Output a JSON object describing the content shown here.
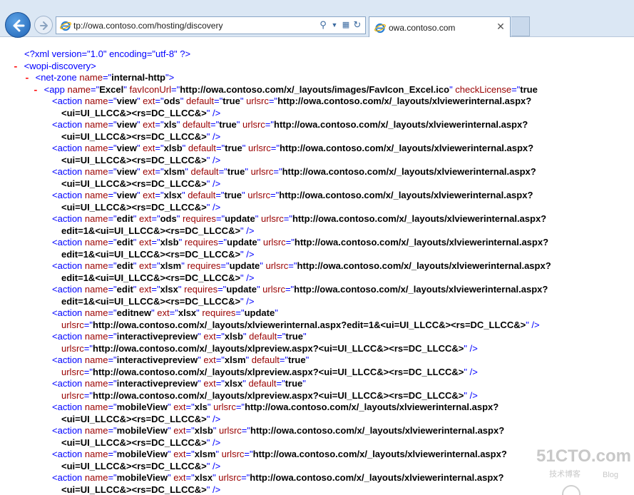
{
  "browser": {
    "address_text": "tp://owa.contoso.com/hosting/discovery",
    "tab_title": "owa.contoso.com",
    "icons": [
      "back-arrow-icon",
      "forward-arrow-icon",
      "ie-logo-icon",
      "search-icon",
      "dropdown-icon",
      "compatibility-icon",
      "refresh-icon",
      "close-icon"
    ],
    "colors": {
      "chrome": "#dbe7f4",
      "tag": "#0000ff",
      "attr_name": "#990000",
      "attr_value": "#000000"
    }
  },
  "xml": {
    "lines": [
      [
        [
          "t",
          "<?xml version=\"1.0\" encoding=\"utf-8\" ?>"
        ]
      ],
      [
        [
          "m",
          "- "
        ],
        [
          "t",
          "<wopi-discovery>"
        ]
      ],
      [
        [
          "m",
          "- "
        ],
        [
          "t",
          "<net-zone "
        ],
        [
          "a",
          "name"
        ],
        [
          "t",
          "=\""
        ],
        [
          "v",
          "internal-http"
        ],
        [
          "t",
          "\">"
        ]
      ],
      [
        [
          "m",
          "- "
        ],
        [
          "t",
          "<app "
        ],
        [
          "a",
          "name"
        ],
        [
          "t",
          "=\""
        ],
        [
          "v",
          "Excel"
        ],
        [
          "t",
          "\" "
        ],
        [
          "a",
          "favIconUrl"
        ],
        [
          "t",
          "=\""
        ],
        [
          "v",
          "http://owa.contoso.com/x/_layouts/images/FavIcon_Excel.ico"
        ],
        [
          "t",
          "\" "
        ],
        [
          "a",
          "checkLicense"
        ],
        [
          "t",
          "=\""
        ],
        [
          "v",
          "true"
        ]
      ],
      [
        [
          "t",
          "<action "
        ],
        [
          "a",
          "name"
        ],
        [
          "t",
          "=\""
        ],
        [
          "v",
          "view"
        ],
        [
          "t",
          "\" "
        ],
        [
          "a",
          "ext"
        ],
        [
          "t",
          "=\""
        ],
        [
          "v",
          "ods"
        ],
        [
          "t",
          "\" "
        ],
        [
          "a",
          "default"
        ],
        [
          "t",
          "=\""
        ],
        [
          "v",
          "true"
        ],
        [
          "t",
          "\" "
        ],
        [
          "a",
          "urlsrc"
        ],
        [
          "t",
          "=\""
        ],
        [
          "v",
          "http://owa.contoso.com/x/_layouts/xlviewerinternal.aspx?"
        ]
      ],
      [
        [
          "v",
          "<ui=UI_LLCC&><rs=DC_LLCC&>"
        ],
        [
          "t",
          "\" />"
        ]
      ],
      [
        [
          "t",
          "<action "
        ],
        [
          "a",
          "name"
        ],
        [
          "t",
          "=\""
        ],
        [
          "v",
          "view"
        ],
        [
          "t",
          "\" "
        ],
        [
          "a",
          "ext"
        ],
        [
          "t",
          "=\""
        ],
        [
          "v",
          "xls"
        ],
        [
          "t",
          "\" "
        ],
        [
          "a",
          "default"
        ],
        [
          "t",
          "=\""
        ],
        [
          "v",
          "true"
        ],
        [
          "t",
          "\" "
        ],
        [
          "a",
          "urlsrc"
        ],
        [
          "t",
          "=\""
        ],
        [
          "v",
          "http://owa.contoso.com/x/_layouts/xlviewerinternal.aspx?"
        ]
      ],
      [
        [
          "v",
          "<ui=UI_LLCC&><rs=DC_LLCC&>"
        ],
        [
          "t",
          "\" />"
        ]
      ],
      [
        [
          "t",
          "<action "
        ],
        [
          "a",
          "name"
        ],
        [
          "t",
          "=\""
        ],
        [
          "v",
          "view"
        ],
        [
          "t",
          "\" "
        ],
        [
          "a",
          "ext"
        ],
        [
          "t",
          "=\""
        ],
        [
          "v",
          "xlsb"
        ],
        [
          "t",
          "\" "
        ],
        [
          "a",
          "default"
        ],
        [
          "t",
          "=\""
        ],
        [
          "v",
          "true"
        ],
        [
          "t",
          "\" "
        ],
        [
          "a",
          "urlsrc"
        ],
        [
          "t",
          "=\""
        ],
        [
          "v",
          "http://owa.contoso.com/x/_layouts/xlviewerinternal.aspx?"
        ]
      ],
      [
        [
          "v",
          "<ui=UI_LLCC&><rs=DC_LLCC&>"
        ],
        [
          "t",
          "\" />"
        ]
      ],
      [
        [
          "t",
          "<action "
        ],
        [
          "a",
          "name"
        ],
        [
          "t",
          "=\""
        ],
        [
          "v",
          "view"
        ],
        [
          "t",
          "\" "
        ],
        [
          "a",
          "ext"
        ],
        [
          "t",
          "=\""
        ],
        [
          "v",
          "xlsm"
        ],
        [
          "t",
          "\" "
        ],
        [
          "a",
          "default"
        ],
        [
          "t",
          "=\""
        ],
        [
          "v",
          "true"
        ],
        [
          "t",
          "\" "
        ],
        [
          "a",
          "urlsrc"
        ],
        [
          "t",
          "=\""
        ],
        [
          "v",
          "http://owa.contoso.com/x/_layouts/xlviewerinternal.aspx?"
        ]
      ],
      [
        [
          "v",
          "<ui=UI_LLCC&><rs=DC_LLCC&>"
        ],
        [
          "t",
          "\" />"
        ]
      ],
      [
        [
          "t",
          "<action "
        ],
        [
          "a",
          "name"
        ],
        [
          "t",
          "=\""
        ],
        [
          "v",
          "view"
        ],
        [
          "t",
          "\" "
        ],
        [
          "a",
          "ext"
        ],
        [
          "t",
          "=\""
        ],
        [
          "v",
          "xlsx"
        ],
        [
          "t",
          "\" "
        ],
        [
          "a",
          "default"
        ],
        [
          "t",
          "=\""
        ],
        [
          "v",
          "true"
        ],
        [
          "t",
          "\" "
        ],
        [
          "a",
          "urlsrc"
        ],
        [
          "t",
          "=\""
        ],
        [
          "v",
          "http://owa.contoso.com/x/_layouts/xlviewerinternal.aspx?"
        ]
      ],
      [
        [
          "v",
          "<ui=UI_LLCC&><rs=DC_LLCC&>"
        ],
        [
          "t",
          "\" />"
        ]
      ],
      [
        [
          "t",
          "<action "
        ],
        [
          "a",
          "name"
        ],
        [
          "t",
          "=\""
        ],
        [
          "v",
          "edit"
        ],
        [
          "t",
          "\" "
        ],
        [
          "a",
          "ext"
        ],
        [
          "t",
          "=\""
        ],
        [
          "v",
          "ods"
        ],
        [
          "t",
          "\" "
        ],
        [
          "a",
          "requires"
        ],
        [
          "t",
          "=\""
        ],
        [
          "v",
          "update"
        ],
        [
          "t",
          "\" "
        ],
        [
          "a",
          "urlsrc"
        ],
        [
          "t",
          "=\""
        ],
        [
          "v",
          "http://owa.contoso.com/x/_layouts/xlviewerinternal.aspx?"
        ]
      ],
      [
        [
          "v",
          "edit=1&<ui=UI_LLCC&><rs=DC_LLCC&>"
        ],
        [
          "t",
          "\" />"
        ]
      ],
      [
        [
          "t",
          "<action "
        ],
        [
          "a",
          "name"
        ],
        [
          "t",
          "=\""
        ],
        [
          "v",
          "edit"
        ],
        [
          "t",
          "\" "
        ],
        [
          "a",
          "ext"
        ],
        [
          "t",
          "=\""
        ],
        [
          "v",
          "xlsb"
        ],
        [
          "t",
          "\" "
        ],
        [
          "a",
          "requires"
        ],
        [
          "t",
          "=\""
        ],
        [
          "v",
          "update"
        ],
        [
          "t",
          "\" "
        ],
        [
          "a",
          "urlsrc"
        ],
        [
          "t",
          "=\""
        ],
        [
          "v",
          "http://owa.contoso.com/x/_layouts/xlviewerinternal.aspx?"
        ]
      ],
      [
        [
          "v",
          "edit=1&<ui=UI_LLCC&><rs=DC_LLCC&>"
        ],
        [
          "t",
          "\" />"
        ]
      ],
      [
        [
          "t",
          "<action "
        ],
        [
          "a",
          "name"
        ],
        [
          "t",
          "=\""
        ],
        [
          "v",
          "edit"
        ],
        [
          "t",
          "\" "
        ],
        [
          "a",
          "ext"
        ],
        [
          "t",
          "=\""
        ],
        [
          "v",
          "xlsm"
        ],
        [
          "t",
          "\" "
        ],
        [
          "a",
          "requires"
        ],
        [
          "t",
          "=\""
        ],
        [
          "v",
          "update"
        ],
        [
          "t",
          "\" "
        ],
        [
          "a",
          "urlsrc"
        ],
        [
          "t",
          "=\""
        ],
        [
          "v",
          "http://owa.contoso.com/x/_layouts/xlviewerinternal.aspx?"
        ]
      ],
      [
        [
          "v",
          "edit=1&<ui=UI_LLCC&><rs=DC_LLCC&>"
        ],
        [
          "t",
          "\" />"
        ]
      ],
      [
        [
          "t",
          "<action "
        ],
        [
          "a",
          "name"
        ],
        [
          "t",
          "=\""
        ],
        [
          "v",
          "edit"
        ],
        [
          "t",
          "\" "
        ],
        [
          "a",
          "ext"
        ],
        [
          "t",
          "=\""
        ],
        [
          "v",
          "xlsx"
        ],
        [
          "t",
          "\" "
        ],
        [
          "a",
          "requires"
        ],
        [
          "t",
          "=\""
        ],
        [
          "v",
          "update"
        ],
        [
          "t",
          "\" "
        ],
        [
          "a",
          "urlsrc"
        ],
        [
          "t",
          "=\""
        ],
        [
          "v",
          "http://owa.contoso.com/x/_layouts/xlviewerinternal.aspx?"
        ]
      ],
      [
        [
          "v",
          "edit=1&<ui=UI_LLCC&><rs=DC_LLCC&>"
        ],
        [
          "t",
          "\" />"
        ]
      ],
      [
        [
          "t",
          "<action "
        ],
        [
          "a",
          "name"
        ],
        [
          "t",
          "=\""
        ],
        [
          "v",
          "editnew"
        ],
        [
          "t",
          "\" "
        ],
        [
          "a",
          "ext"
        ],
        [
          "t",
          "=\""
        ],
        [
          "v",
          "xlsx"
        ],
        [
          "t",
          "\" "
        ],
        [
          "a",
          "requires"
        ],
        [
          "t",
          "=\""
        ],
        [
          "v",
          "update"
        ],
        [
          "t",
          "\""
        ]
      ],
      [
        [
          "a",
          "urlsrc"
        ],
        [
          "t",
          "=\""
        ],
        [
          "v",
          "http://owa.contoso.com/x/_layouts/xlviewerinternal.aspx?edit=1&<ui=UI_LLCC&><rs=DC_LLCC&>"
        ],
        [
          "t",
          "\" />"
        ]
      ],
      [
        [
          "t",
          "<action "
        ],
        [
          "a",
          "name"
        ],
        [
          "t",
          "=\""
        ],
        [
          "v",
          "interactivepreview"
        ],
        [
          "t",
          "\" "
        ],
        [
          "a",
          "ext"
        ],
        [
          "t",
          "=\""
        ],
        [
          "v",
          "xlsb"
        ],
        [
          "t",
          "\" "
        ],
        [
          "a",
          "default"
        ],
        [
          "t",
          "=\""
        ],
        [
          "v",
          "true"
        ],
        [
          "t",
          "\""
        ]
      ],
      [
        [
          "a",
          "urlsrc"
        ],
        [
          "t",
          "=\""
        ],
        [
          "v",
          "http://owa.contoso.com/x/_layouts/xlpreview.aspx?<ui=UI_LLCC&><rs=DC_LLCC&>"
        ],
        [
          "t",
          "\" />"
        ]
      ],
      [
        [
          "t",
          "<action "
        ],
        [
          "a",
          "name"
        ],
        [
          "t",
          "=\""
        ],
        [
          "v",
          "interactivepreview"
        ],
        [
          "t",
          "\" "
        ],
        [
          "a",
          "ext"
        ],
        [
          "t",
          "=\""
        ],
        [
          "v",
          "xlsm"
        ],
        [
          "t",
          "\" "
        ],
        [
          "a",
          "default"
        ],
        [
          "t",
          "=\""
        ],
        [
          "v",
          "true"
        ],
        [
          "t",
          "\""
        ]
      ],
      [
        [
          "a",
          "urlsrc"
        ],
        [
          "t",
          "=\""
        ],
        [
          "v",
          "http://owa.contoso.com/x/_layouts/xlpreview.aspx?<ui=UI_LLCC&><rs=DC_LLCC&>"
        ],
        [
          "t",
          "\" />"
        ]
      ],
      [
        [
          "t",
          "<action "
        ],
        [
          "a",
          "name"
        ],
        [
          "t",
          "=\""
        ],
        [
          "v",
          "interactivepreview"
        ],
        [
          "t",
          "\" "
        ],
        [
          "a",
          "ext"
        ],
        [
          "t",
          "=\""
        ],
        [
          "v",
          "xlsx"
        ],
        [
          "t",
          "\" "
        ],
        [
          "a",
          "default"
        ],
        [
          "t",
          "=\""
        ],
        [
          "v",
          "true"
        ],
        [
          "t",
          "\""
        ]
      ],
      [
        [
          "a",
          "urlsrc"
        ],
        [
          "t",
          "=\""
        ],
        [
          "v",
          "http://owa.contoso.com/x/_layouts/xlpreview.aspx?<ui=UI_LLCC&><rs=DC_LLCC&>"
        ],
        [
          "t",
          "\" />"
        ]
      ],
      [
        [
          "t",
          "<action "
        ],
        [
          "a",
          "name"
        ],
        [
          "t",
          "=\""
        ],
        [
          "v",
          "mobileView"
        ],
        [
          "t",
          "\" "
        ],
        [
          "a",
          "ext"
        ],
        [
          "t",
          "=\""
        ],
        [
          "v",
          "xls"
        ],
        [
          "t",
          "\" "
        ],
        [
          "a",
          "urlsrc"
        ],
        [
          "t",
          "=\""
        ],
        [
          "v",
          "http://owa.contoso.com/x/_layouts/xlviewerinternal.aspx?"
        ]
      ],
      [
        [
          "v",
          "<ui=UI_LLCC&><rs=DC_LLCC&>"
        ],
        [
          "t",
          "\" />"
        ]
      ],
      [
        [
          "t",
          "<action "
        ],
        [
          "a",
          "name"
        ],
        [
          "t",
          "=\""
        ],
        [
          "v",
          "mobileView"
        ],
        [
          "t",
          "\" "
        ],
        [
          "a",
          "ext"
        ],
        [
          "t",
          "=\""
        ],
        [
          "v",
          "xlsb"
        ],
        [
          "t",
          "\" "
        ],
        [
          "a",
          "urlsrc"
        ],
        [
          "t",
          "=\""
        ],
        [
          "v",
          "http://owa.contoso.com/x/_layouts/xlviewerinternal.aspx?"
        ]
      ],
      [
        [
          "v",
          "<ui=UI_LLCC&><rs=DC_LLCC&>"
        ],
        [
          "t",
          "\" />"
        ]
      ],
      [
        [
          "t",
          "<action "
        ],
        [
          "a",
          "name"
        ],
        [
          "t",
          "=\""
        ],
        [
          "v",
          "mobileView"
        ],
        [
          "t",
          "\" "
        ],
        [
          "a",
          "ext"
        ],
        [
          "t",
          "=\""
        ],
        [
          "v",
          "xlsm"
        ],
        [
          "t",
          "\" "
        ],
        [
          "a",
          "urlsrc"
        ],
        [
          "t",
          "=\""
        ],
        [
          "v",
          "http://owa.contoso.com/x/_layouts/xlviewerinternal.aspx?"
        ]
      ],
      [
        [
          "v",
          "<ui=UI_LLCC&><rs=DC_LLCC&>"
        ],
        [
          "t",
          "\" />"
        ]
      ],
      [
        [
          "t",
          "<action "
        ],
        [
          "a",
          "name"
        ],
        [
          "t",
          "=\""
        ],
        [
          "v",
          "mobileView"
        ],
        [
          "t",
          "\" "
        ],
        [
          "a",
          "ext"
        ],
        [
          "t",
          "=\""
        ],
        [
          "v",
          "xlsx"
        ],
        [
          "t",
          "\" "
        ],
        [
          "a",
          "urlsrc"
        ],
        [
          "t",
          "=\""
        ],
        [
          "v",
          "http://owa.contoso.com/x/_layouts/xlviewerinternal.aspx?"
        ]
      ],
      [
        [
          "v",
          "<ui=UI_LLCC&><rs=DC_LLCC&>"
        ],
        [
          "t",
          "\" />"
        ]
      ]
    ]
  },
  "watermark": {
    "main": "51CTO.com",
    "sub": "技术博客",
    "blog": "Blog"
  }
}
